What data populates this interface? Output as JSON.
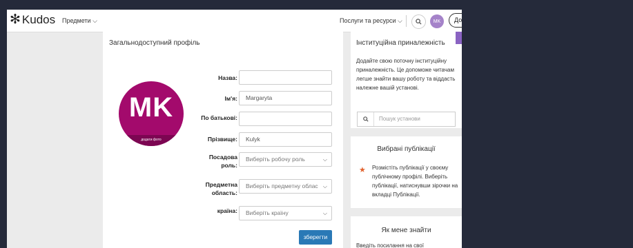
{
  "navbar": {
    "logo": "Kudos",
    "subjects": "Предмети",
    "services": "Послуги та ресурси",
    "avatar_initials": "MK",
    "add_button": "Додати"
  },
  "profile": {
    "title": "Загальнодоступний профіль",
    "avatar_initials": "MK",
    "add_photo": "додати фото",
    "fields": {
      "title_label": "Назва:",
      "title_value": "",
      "first_name_label": "Ім'я:",
      "first_name_value": "Margaryta",
      "middle_name_label": "По батькові:",
      "middle_name_value": "",
      "last_name_label": "Прізвище:",
      "last_name_value": "Kulyk",
      "role_label": "Посадова роль:",
      "role_value": "Виберіть робочу роль",
      "subject_label": "Предметна область:",
      "subject_value": "Виберіть предметну облас",
      "country_label": "країна:",
      "country_value": "Виберіть країну"
    },
    "save_button": "зберегти"
  },
  "affiliation": {
    "title": "Інституційна приналежність",
    "text": "Додайте свою поточну інституційну приналежність. Це допоможе читачам легше знайти вашу роботу та віддасть належне вашій установі.",
    "search_placeholder": "Пошук установи"
  },
  "featured": {
    "title": "Вибрані публікації",
    "text": "Розмістіть публікації у своєму публічному профілі. Виберіть публікації, натиснувши зірочки на вкладці Публікації."
  },
  "find_me": {
    "title": "Як мене знайти",
    "text": "Введіть посилання на свої"
  }
}
